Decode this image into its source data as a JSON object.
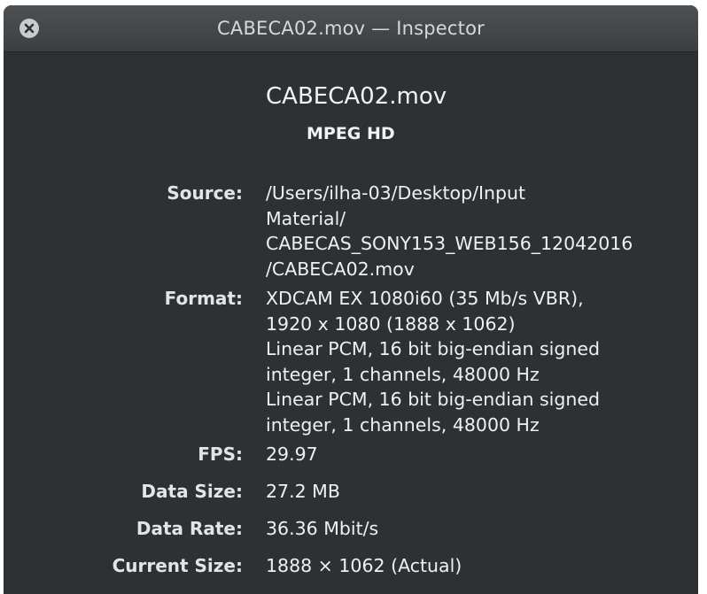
{
  "window": {
    "title": "CABECA02.mov — Inspector",
    "close_icon": "close-circle-x"
  },
  "file": {
    "name": "CABECA02.mov",
    "kind": "MPEG HD"
  },
  "info": {
    "source": {
      "label": "Source:",
      "lines": [
        "/Users/ilha-03/Desktop/Input",
        "Material/",
        "CABECAS_SONY153_WEB156_12042016",
        "/CABECA02.mov"
      ]
    },
    "format": {
      "label": "Format:",
      "lines": [
        "XDCAM EX 1080i60 (35 Mb/s VBR),",
        "1920 x 1080 (1888 x 1062)",
        "Linear PCM, 16 bit big-endian signed",
        "integer, 1 channels, 48000 Hz",
        "Linear PCM, 16 bit big-endian signed",
        "integer, 1 channels, 48000 Hz"
      ]
    },
    "fps": {
      "label": "FPS:",
      "value": "29.97"
    },
    "data_size": {
      "label": "Data Size:",
      "value": "27.2 MB"
    },
    "data_rate": {
      "label": "Data Rate:",
      "value": "36.36 Mbit/s"
    },
    "current_size": {
      "label": "Current Size:",
      "value": "1888 × 1062 (Actual)"
    }
  },
  "colors": {
    "window_background": "#2e3133",
    "titlebar": "#43474a",
    "text": "#f0f0f0"
  }
}
